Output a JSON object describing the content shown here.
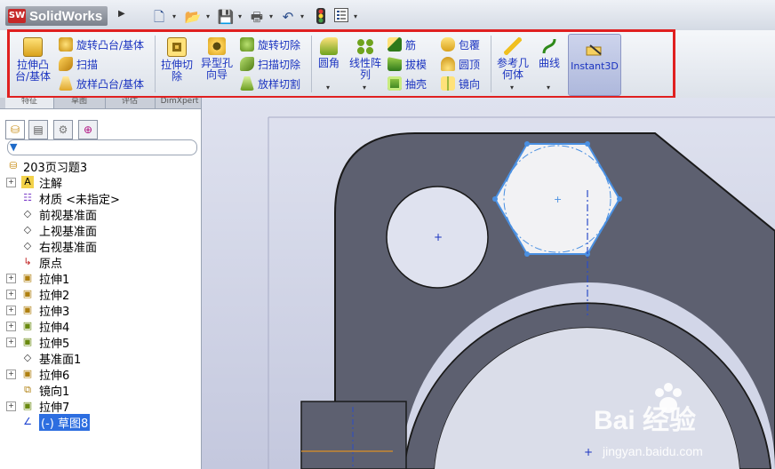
{
  "app": {
    "name": "SolidWorks",
    "logo_mark": "SW"
  },
  "quick_access": [
    {
      "icon": "new-document-icon"
    },
    {
      "icon": "open-folder-icon"
    },
    {
      "icon": "save-icon"
    },
    {
      "icon": "print-icon"
    },
    {
      "icon": "undo-icon"
    },
    {
      "icon": "rebuild-icon"
    },
    {
      "icon": "options-icon"
    }
  ],
  "commands": {
    "extrude_boss": "拉伸凸台/基体",
    "revolve_boss": "旋转凸台/基体",
    "sweep": "扫描",
    "loft_boss": "放样凸台/基体",
    "extrude_cut": "拉伸切除",
    "hole_wizard": "异型孔向导",
    "revolve_cut": "旋转切除",
    "sweep_cut": "扫描切除",
    "loft_cut": "放样切割",
    "fillet": "圆角",
    "linear_pattern": "线性阵列",
    "rib": "筋",
    "draft": "拔模",
    "shell": "抽壳",
    "wrap": "包覆",
    "dome": "圆顶",
    "mirror": "镜向",
    "reference_geometry": "参考几何体",
    "curves": "曲线",
    "instant3d": "Instant3D"
  },
  "panel_tabs": [
    "特征",
    "草图",
    "评估",
    "DimXpert"
  ],
  "filter_placeholder": "",
  "tree": {
    "root": "203页习题3",
    "items": [
      {
        "label": "注解",
        "icon": "annotation-icon",
        "expandable": true
      },
      {
        "label": "材质 <未指定>",
        "icon": "material-icon",
        "expandable": false
      },
      {
        "label": "前视基准面",
        "icon": "plane-icon",
        "expandable": false
      },
      {
        "label": "上视基准面",
        "icon": "plane-icon",
        "expandable": false
      },
      {
        "label": "右视基准面",
        "icon": "plane-icon",
        "expandable": false
      },
      {
        "label": "原点",
        "icon": "origin-icon",
        "expandable": false
      },
      {
        "label": "拉伸1",
        "icon": "extrude-icon",
        "expandable": true
      },
      {
        "label": "拉伸2",
        "icon": "extrude-icon",
        "expandable": true
      },
      {
        "label": "拉伸3",
        "icon": "extrude-icon",
        "expandable": true
      },
      {
        "label": "拉伸4",
        "icon": "extrude-cut-icon",
        "expandable": true
      },
      {
        "label": "拉伸5",
        "icon": "extrude-cut-icon",
        "expandable": true
      },
      {
        "label": "基准面1",
        "icon": "plane-icon",
        "expandable": false
      },
      {
        "label": "拉伸6",
        "icon": "extrude-icon",
        "expandable": true
      },
      {
        "label": "镜向1",
        "icon": "mirror-icon",
        "expandable": false
      },
      {
        "label": "拉伸7",
        "icon": "extrude-cut-icon",
        "expandable": true
      },
      {
        "label": "(-) 草图8",
        "icon": "sketch-icon",
        "expandable": false,
        "selected": true
      }
    ]
  },
  "watermark": {
    "main": "Bai 经验",
    "sub": "jingyan.baidu.com"
  },
  "colors": {
    "highlight_border": "#e02020",
    "part_face": "#5d6070",
    "sketch_line": "#4a90e2",
    "command_text": "#1a33c0",
    "tree_selection": "#2d6ee0"
  }
}
